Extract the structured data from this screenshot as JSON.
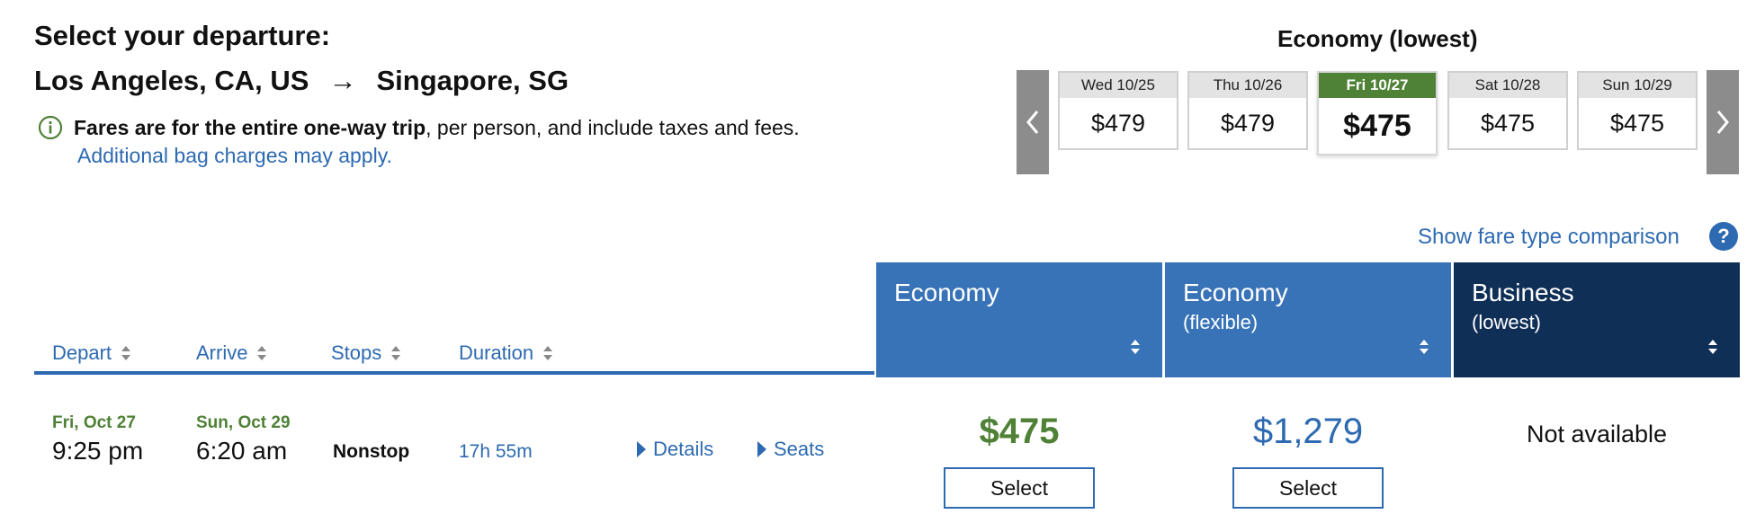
{
  "header": {
    "title": "Select your departure:",
    "origin": "Los Angeles, CA, US",
    "arrow": "→",
    "destination": "Singapore, SG",
    "fare_note_bold": "Fares are for the entire one-way trip",
    "fare_note_rest": ", per person, and include taxes and fees.",
    "bag_link": "Additional bag charges may apply."
  },
  "carousel": {
    "label": "Economy (lowest)",
    "days": [
      {
        "date": "Wed 10/25",
        "price": "$479",
        "selected": false
      },
      {
        "date": "Thu 10/26",
        "price": "$479",
        "selected": false
      },
      {
        "date": "Fri 10/27",
        "price": "$475",
        "selected": true
      },
      {
        "date": "Sat 10/28",
        "price": "$475",
        "selected": false
      },
      {
        "date": "Sun 10/29",
        "price": "$475",
        "selected": false
      }
    ],
    "prev_icon": "chevron-left-icon",
    "next_icon": "chevron-right-icon"
  },
  "compare": {
    "link": "Show fare type comparison",
    "help": "?"
  },
  "sort_headers": [
    "Depart",
    "Arrive",
    "Stops",
    "Duration"
  ],
  "fare_columns": [
    {
      "title": "Economy",
      "subtitle": "",
      "color": "#3873b8"
    },
    {
      "title": "Economy",
      "subtitle": "(flexible)",
      "color": "#3873b8"
    },
    {
      "title": "Business",
      "subtitle": "(lowest)",
      "color": "#0f2f57"
    }
  ],
  "flight": {
    "depart_date": "Fri, Oct 27",
    "depart_time": "9:25 pm",
    "arrive_date": "Sun, Oct 29",
    "arrive_time": "6:20 am",
    "stops": "Nonstop",
    "duration": "17h 55m",
    "details_link": "Details",
    "seats_link": "Seats",
    "economy_price": "$475",
    "flexible_price": "$1,279",
    "business": "Not available",
    "select_label": "Select"
  },
  "colors": {
    "accent_blue": "#2d6ab1",
    "green": "#4f8136",
    "navy": "#0f2f57"
  }
}
